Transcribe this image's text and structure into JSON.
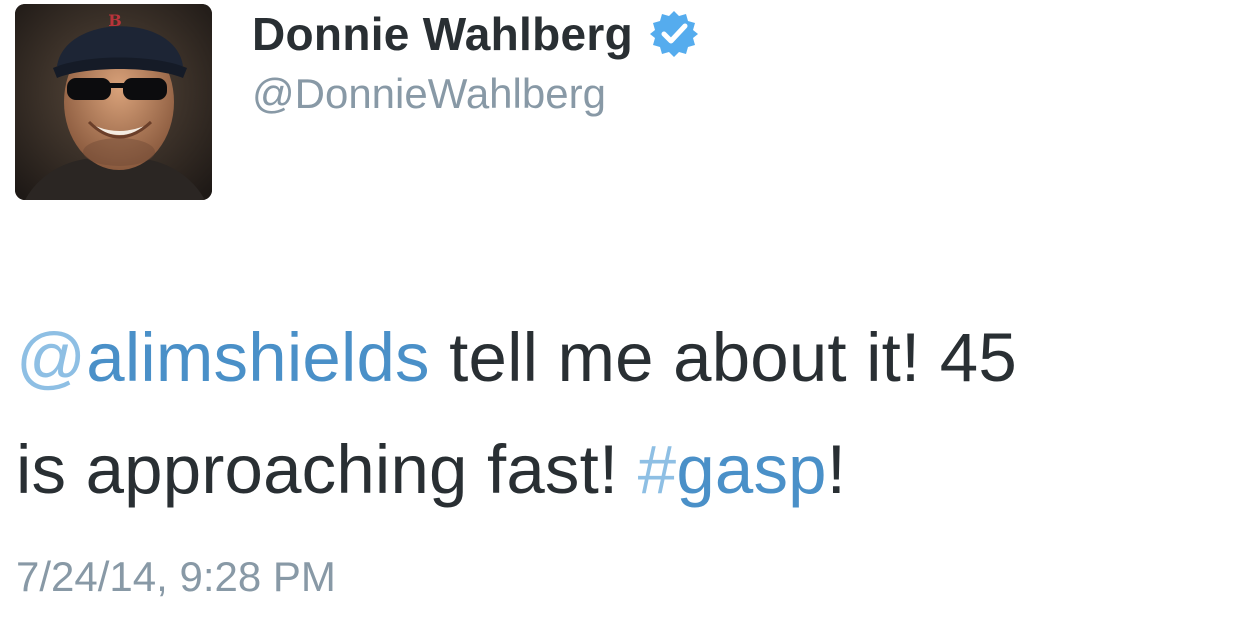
{
  "author": {
    "display_name": "Donnie Wahlberg",
    "handle": "@DonnieWahlberg",
    "verified": true,
    "avatar_icon": "profile-photo"
  },
  "tweet": {
    "mention_at": "@",
    "mention_name": "alimshields",
    "text_part1": " tell me about it!  45",
    "text_part2": "is approaching fast!  ",
    "hashtag_sign": "#",
    "hashtag_name": "gasp",
    "text_part3": "!"
  },
  "timestamp": "7/24/14, 9:28 PM",
  "colors": {
    "link": "#4a90c8",
    "muted": "#8899a6",
    "text": "#292f33",
    "verified_badge": "#55acee"
  }
}
